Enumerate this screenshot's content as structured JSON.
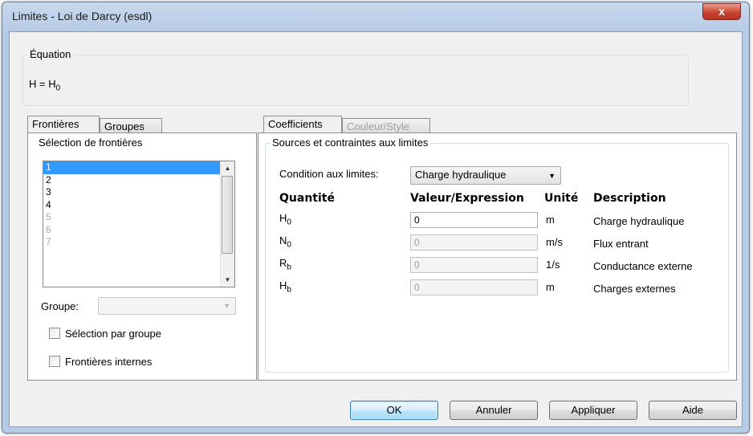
{
  "window": {
    "title": "Limites - Loi de Darcy (esdl)",
    "close_glyph": "x"
  },
  "equation": {
    "legend": "Équation",
    "lhs": "H = H",
    "sub": "0"
  },
  "left_tabs": [
    {
      "label": "Frontières"
    },
    {
      "label": "Groupes"
    }
  ],
  "boundaries": {
    "legend": "Sélection de frontières",
    "items": [
      "1",
      "2",
      "3",
      "4",
      "5",
      "6",
      "7"
    ],
    "group_label": "Groupe:",
    "group_value": "",
    "select_by_group": "Sélection par groupe",
    "internal_boundaries": "Frontières internes"
  },
  "right_tabs": [
    {
      "label": "Coefficients"
    },
    {
      "label": "Couleur/Style"
    }
  ],
  "sources": {
    "legend": "Sources et contraintes aux limites",
    "condition_label": "Condition aux limites:",
    "condition_value": "Charge hydraulique",
    "headers": {
      "quantity": "Quantité",
      "value": "Valeur/Expression",
      "unit": "Unité",
      "description": "Description"
    },
    "rows": [
      {
        "symbol": "H",
        "sub": "0",
        "value": "0",
        "unit": "m",
        "description": "Charge hydraulique",
        "enabled": true
      },
      {
        "symbol": "N",
        "sub": "0",
        "value": "0",
        "unit": "m/s",
        "description": "Flux entrant",
        "enabled": false
      },
      {
        "symbol": "R",
        "sub": "b",
        "value": "0",
        "unit": "1/s",
        "description": "Conductance externe",
        "enabled": false
      },
      {
        "symbol": "H",
        "sub": "b",
        "value": "0",
        "unit": "m",
        "description": "Charges externes",
        "enabled": false
      }
    ]
  },
  "buttons": {
    "ok": "OK",
    "cancel": "Annuler",
    "apply": "Appliquer",
    "help": "Aide"
  }
}
